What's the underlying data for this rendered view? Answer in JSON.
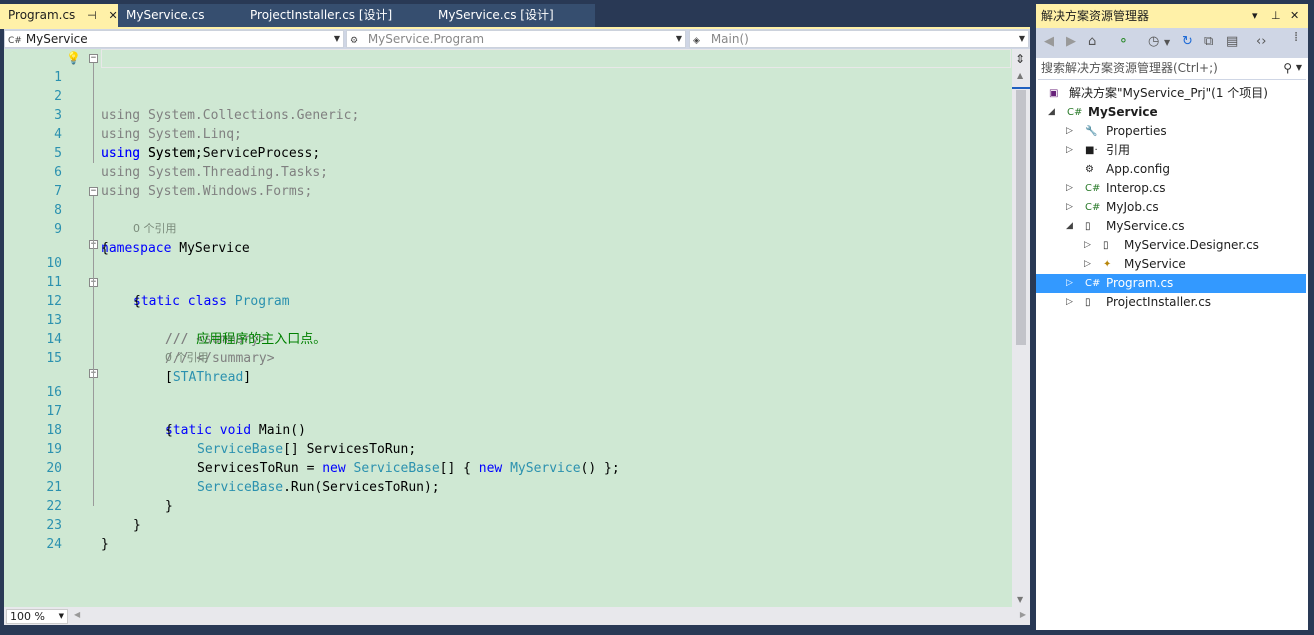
{
  "tabs": [
    {
      "label": "Program.cs",
      "pin": "⊣",
      "close": "✕"
    },
    {
      "label": "MyService.cs"
    },
    {
      "label": "ProjectInstaller.cs [设计]"
    },
    {
      "label": "MyService.cs [设计]"
    }
  ],
  "navbar": {
    "project": "MyService",
    "class": "MyService.Program",
    "member": "Main()"
  },
  "code": {
    "lines": [
      {
        "n": "1"
      },
      {
        "n": "2"
      },
      {
        "n": "3"
      },
      {
        "n": "4"
      },
      {
        "n": "5"
      },
      {
        "n": "6"
      },
      {
        "n": "7"
      },
      {
        "n": "8"
      },
      {
        "n": "9"
      },
      {
        "n": "10"
      },
      {
        "n": "11"
      },
      {
        "n": "12"
      },
      {
        "n": "13"
      },
      {
        "n": "14"
      },
      {
        "n": "15"
      },
      {
        "n": "16"
      },
      {
        "n": "17"
      },
      {
        "n": "18"
      },
      {
        "n": "19"
      },
      {
        "n": "20"
      },
      {
        "n": "21"
      },
      {
        "n": "22"
      },
      {
        "n": "23"
      },
      {
        "n": "24"
      }
    ],
    "t": {
      "using": "using",
      "system": " System;",
      "collections": " System.Collections.Generic;",
      "linq": " System.Linq;",
      "serviceprocess": " System.ServiceProcess;",
      "threading": " System.Threading.Tasks;",
      "forms": " System.Windows.Forms;",
      "namespace": "namespace",
      "ns_name": " MyService",
      "open": "{",
      "close": "}",
      "static": "static",
      "class": " class ",
      "program": "Program",
      "doc": "///",
      "summary_open": " <summary>",
      "summary_text": " 应用程序的主入口点。",
      "summary_close": " </summary>",
      "bracket_open": "[",
      "stathread": "STAThread",
      "bracket_close": "]",
      "void": " void",
      "main": " Main()",
      "servicebase": "ServiceBase",
      "array_decl": "[] ServicesToRun;",
      "assign": "ServicesToRun = ",
      "new": "new",
      "sp": " ",
      "array_open": "[] { ",
      "myservice": "MyService",
      "tail": "() };",
      "run": ".Run(ServicesToRun);"
    },
    "ref_hint": "0 个引用",
    "zoom": "100 %"
  },
  "solution_explorer": {
    "title": "解决方案资源管理器",
    "title_controls": [
      "▾",
      "⊥",
      "✕"
    ],
    "search_placeholder": "搜索解决方案资源管理器(Ctrl+;)",
    "tree": [
      {
        "label": "解决方案\"MyService_Prj\"(1 个项目)",
        "icon": "solution-icon",
        "glyph": "▣",
        "expander": ""
      },
      {
        "label": "MyService",
        "icon": "csharp-project-icon",
        "glyph": "C#",
        "expander": "◢"
      },
      {
        "label": "Properties",
        "icon": "wrench-icon",
        "glyph": "🔧",
        "expander": "▷"
      },
      {
        "label": "引用",
        "icon": "references-icon",
        "glyph": "■·",
        "expander": "▷"
      },
      {
        "label": "App.config",
        "icon": "config-file-icon",
        "glyph": "⚙",
        "expander": ""
      },
      {
        "label": "Interop.cs",
        "icon": "csharp-file-icon",
        "glyph": "C#",
        "expander": "▷"
      },
      {
        "label": "MyJob.cs",
        "icon": "csharp-file-icon",
        "glyph": "C#",
        "expander": "▷"
      },
      {
        "label": "MyService.cs",
        "icon": "file-icon",
        "glyph": "▯",
        "expander": "◢"
      },
      {
        "label": "MyService.Designer.cs",
        "icon": "file-icon",
        "glyph": "▯",
        "expander": "▷"
      },
      {
        "label": "MyService",
        "icon": "component-icon",
        "glyph": "✦",
        "expander": "▷"
      },
      {
        "label": "Program.cs",
        "icon": "csharp-class-icon",
        "glyph": "C#",
        "expander": "▷"
      },
      {
        "label": "ProjectInstaller.cs",
        "icon": "file-icon",
        "glyph": "▯",
        "expander": "▷"
      }
    ]
  },
  "colors": {
    "editor_background": "#cfe8d3",
    "active_tab": "#fff1a8",
    "chrome": "#293955",
    "keyword": "#0000ff",
    "type": "#2b91af",
    "comment": "#008000",
    "selection": "#3399ff"
  }
}
